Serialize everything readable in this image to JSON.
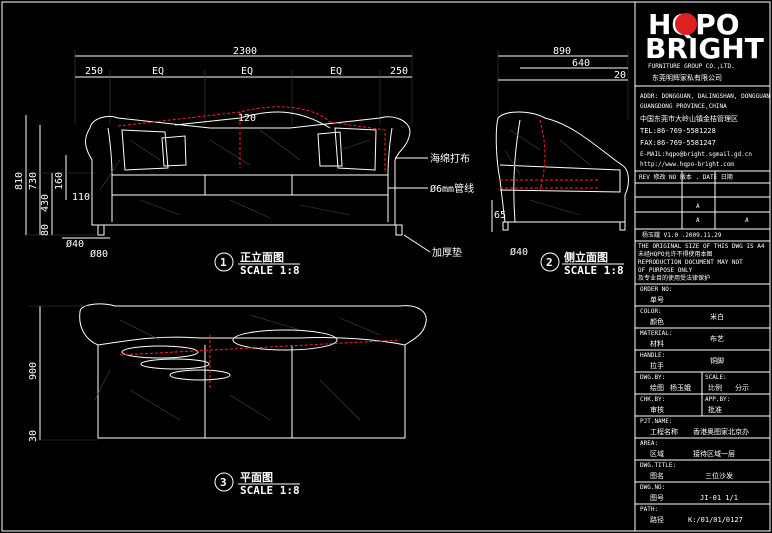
{
  "logo": {
    "line1": "HQPO",
    "line2": "BRIGHT",
    "line3": "FURNITURE GROUP CO.,LTD.",
    "cn_name": "东莞明辉家私有限公司"
  },
  "company": {
    "address_en_1": "ADDR: DONGGUAN, DALINGSHAN, DONGGUAN",
    "address_en_2": "GUANGDONG PROVINCE,CHINA",
    "address_cn": "中国东莞市大岭山镇金桔管理区",
    "tel": "TEL:86-769-5581228",
    "fax": "FAX:86-769-5581247",
    "email": "E-MAIL:hqpo@bright.sgmail.gd.cn",
    "web": "http://www.hqpo-bright.com"
  },
  "revision": {
    "header": "REV 修改  NO 版本 . DATE 日期",
    "rows": [
      "",
      "A",
      "A",
      "A"
    ],
    "signer": "杨玉娥   V1.0 .2009.11.29"
  },
  "notice": [
    "THE ORIGINAL SIZE OF THIS DWG IS A4",
    "未经HQPO允许不得使用本图",
    "REPRODUCTION DOCUMENT MAY NOT",
    "OF PURPOSE ONLY",
    "及专业目的使用受法律保护"
  ],
  "fields": [
    {
      "en": "ORDER NO:",
      "cn": "单号",
      "val": ""
    },
    {
      "en": "COLOR:",
      "cn": "颜色",
      "val": "米白"
    },
    {
      "en": "MATERIAL:",
      "cn": "材料",
      "val": "布艺"
    },
    {
      "en": "HANDLE:",
      "cn": "拉手",
      "val": "铜脚"
    },
    {
      "en": "DWG.BY:",
      "cn": "绘图",
      "val": "杨玉娥",
      "en2": "SCALE:",
      "cn2": "比例",
      "val2": "分示"
    },
    {
      "en": "CHK.BY:",
      "cn": "审核",
      "val": "",
      "en2": "APP.BY:",
      "cn2": "批准",
      "val2": ""
    },
    {
      "en": "PJT.NAME:",
      "cn": "工程名称",
      "val": "香港奥图家北京办"
    },
    {
      "en": "AREA:",
      "cn": "区域",
      "val": "接待区域一层"
    },
    {
      "en": "DWG.TITLE:",
      "cn": "图名",
      "val": "三位沙发"
    },
    {
      "en": "DWG.NO:",
      "cn": "图号",
      "val": "JI-01   1/1"
    },
    {
      "en": "PATH:",
      "cn": "路径",
      "val": "K:/01/01/0127"
    }
  ],
  "front_view": {
    "overall": "2300",
    "segments": [
      "250",
      "EQ",
      "EQ",
      "EQ",
      "250"
    ],
    "heights": [
      "810",
      "730",
      "430",
      "160",
      "110",
      "80"
    ],
    "legs": [
      "Ø40",
      "Ø80"
    ],
    "callouts": [
      "120",
      "海绵打布",
      "Ø6mm管线",
      "加厚垫"
    ],
    "label_num": "1",
    "label_cn": "正立面图",
    "label_scale": "SCALE 1:8"
  },
  "side_view": {
    "overall": "890",
    "inner": "640",
    "offset": "20",
    "height": "65",
    "leg": "Ø40",
    "label_num": "2",
    "label_cn": "侧立面图",
    "label_scale": "SCALE 1:8"
  },
  "plan_view": {
    "depth": "900",
    "edge": "30",
    "label_num": "3",
    "label_cn": "平面图",
    "label_scale": "SCALE 1:8"
  }
}
